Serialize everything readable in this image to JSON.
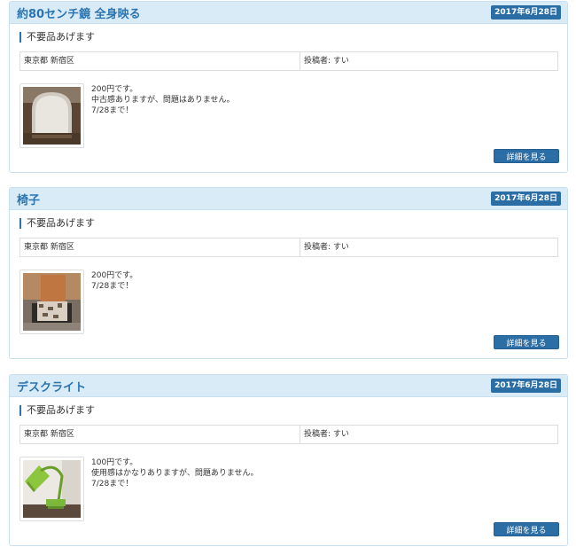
{
  "listings": [
    {
      "title": "約80センチ鏡 全身映る",
      "date": "2017年6月28日",
      "category": "不要品あげます",
      "location": "東京都 新宿区",
      "poster": "投稿者: すい",
      "description": [
        "200円です。",
        "中古感ありますが、問題はありません。",
        "7/28まで！"
      ],
      "image": "mirror-photo",
      "button_label": "詳細を見る"
    },
    {
      "title": "椅子",
      "date": "2017年6月28日",
      "category": "不要品あげます",
      "location": "東京都 新宿区",
      "poster": "投稿者: すい",
      "description": [
        "200円です。",
        "7/28まで！"
      ],
      "image": "chair-photo",
      "button_label": "詳細を見る"
    },
    {
      "title": "デスクライト",
      "date": "2017年6月28日",
      "category": "不要品あげます",
      "location": "東京都 新宿区",
      "poster": "投稿者: すい",
      "description": [
        "100円です。",
        "使用感はかなりありますが、問題ありません。",
        "7/28まで！"
      ],
      "image": "desk-lamp-photo",
      "button_label": "詳細を見る"
    }
  ],
  "colors": {
    "header_bg": "#d8ebf6",
    "title_text": "#2b74b0",
    "badge_bg": "#2b6ea6",
    "button_bg": "#2b6ea6",
    "card_border": "#c7dfee"
  }
}
